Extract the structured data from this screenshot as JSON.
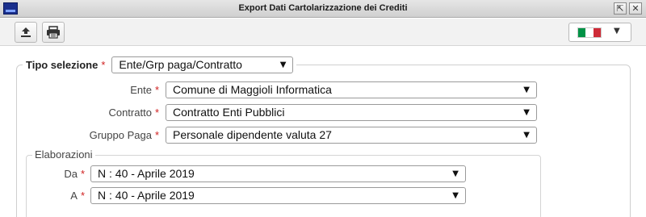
{
  "window": {
    "title": "Export Dati Cartolarizzazione dei Crediti",
    "restore_glyph": "⇱",
    "close_glyph": "✕"
  },
  "toolbar": {
    "export_icon": "upload-icon",
    "print_icon": "printer-icon",
    "language": {
      "flag": "italian-flag",
      "flag_colors": [
        "#009246",
        "#ffffff",
        "#ce2b37"
      ],
      "caret": "▼"
    }
  },
  "form": {
    "required_marker": "*",
    "tipo_selezione": {
      "label": "Tipo selezione",
      "value": "Ente/Grp paga/Contratto"
    },
    "fields": [
      {
        "label": "Ente",
        "value": "Comune di Maggioli Informatica"
      },
      {
        "label": "Contratto",
        "value": "Contratto Enti Pubblici"
      },
      {
        "label": "Gruppo Paga",
        "value": "Personale dipendente valuta 27"
      }
    ],
    "elaborazioni": {
      "legend": "Elaborazioni",
      "da": {
        "label": "Da",
        "value": "N : 40 - Aprile 2019"
      },
      "a": {
        "label": "A",
        "value": "N : 40 - Aprile 2019"
      }
    }
  },
  "colors": {
    "required": "#d02020"
  }
}
